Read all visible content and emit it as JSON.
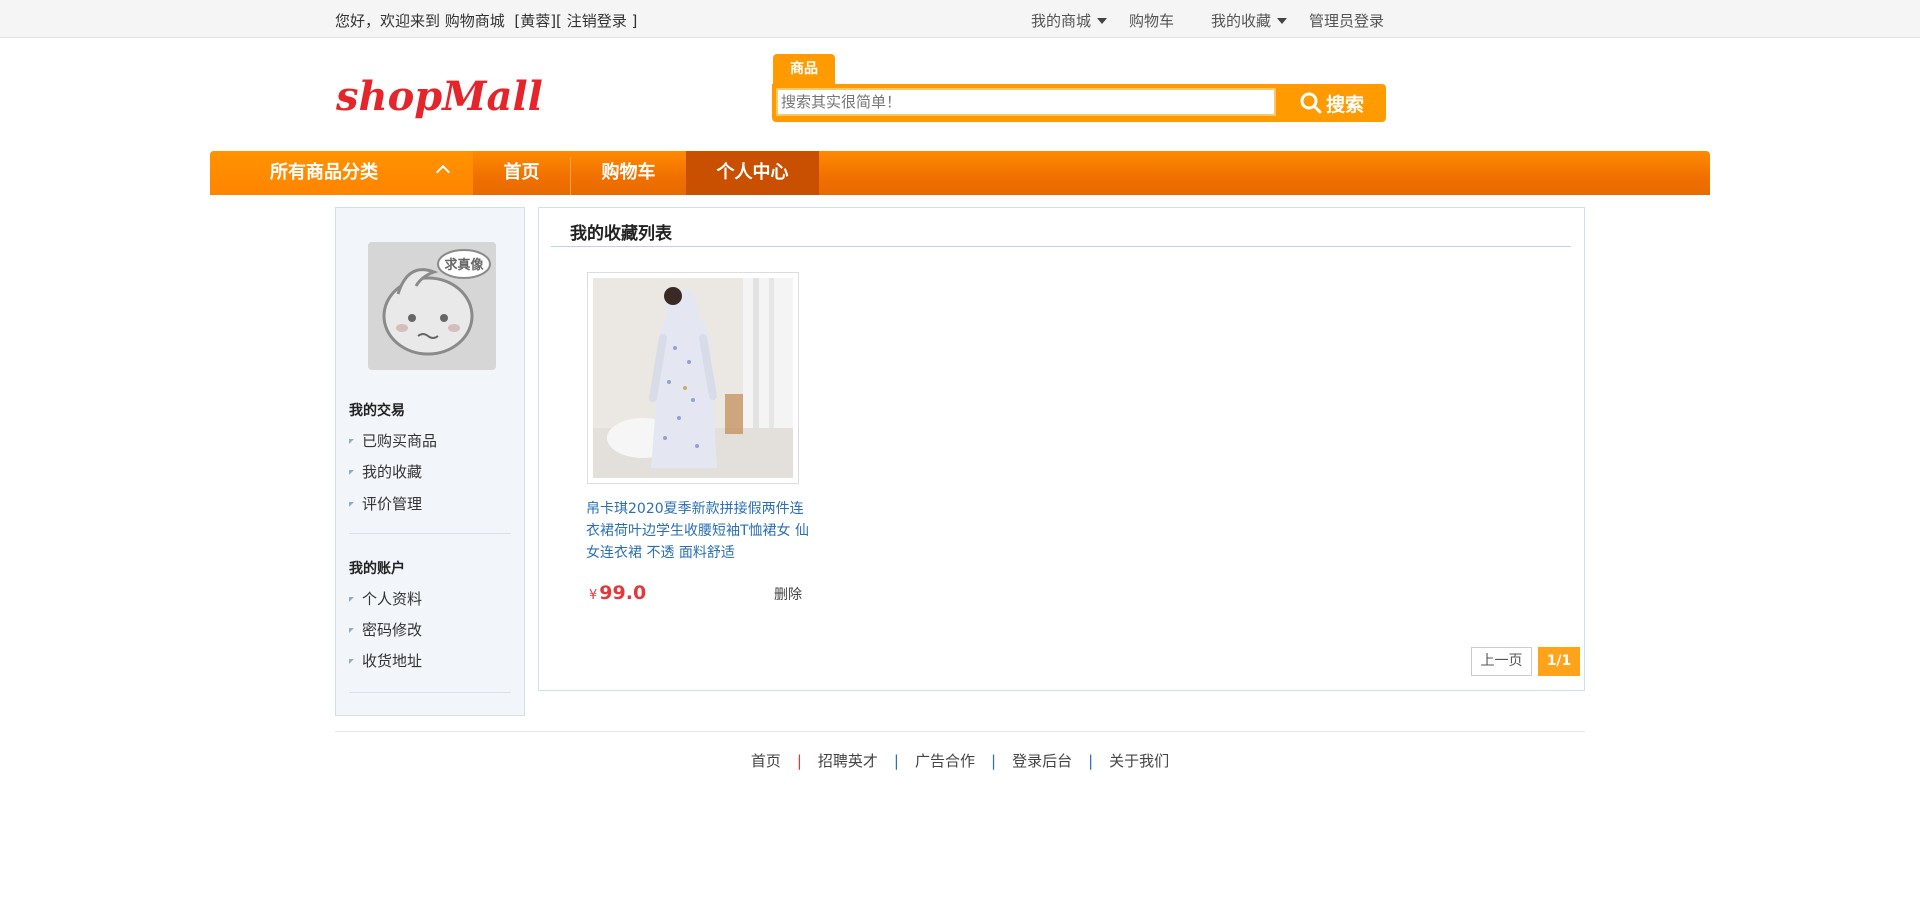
{
  "topbar": {
    "greeting": "您好，欢迎来到 购物商城",
    "user_open": "[",
    "username": "黄蓉",
    "user_close": "][",
    "logout": "注销登录",
    "logout_close": "]",
    "links": {
      "my_mall": "我的商城",
      "cart": "购物车",
      "favorites": "我的收藏",
      "admin_login": "管理员登录"
    }
  },
  "header": {
    "logo_text": "shopMall",
    "search_tab": "商品",
    "search_placeholder": "搜索其实很简单！",
    "search_button": "搜索"
  },
  "nav": {
    "all_categories": "所有商品分类",
    "items": [
      "首页",
      "购物车",
      "个人中心"
    ],
    "active": "个人中心"
  },
  "sidebar": {
    "avatar_badge": "求真像",
    "sections": [
      {
        "title": "我的交易",
        "links": [
          "已购买商品",
          "我的收藏",
          "评价管理"
        ]
      },
      {
        "title": "我的账户",
        "links": [
          "个人资料",
          "密码修改",
          "收货地址"
        ]
      }
    ]
  },
  "main": {
    "title": "我的收藏列表",
    "products": [
      {
        "name": "帛卡琪2020夏季新款拼接假两件连衣裙荷叶边学生收腰短袖T恤裙女 仙女连衣裙 不透 面料舒适",
        "currency": "¥",
        "price": "99.0",
        "delete_label": "删除"
      }
    ],
    "pagination": {
      "prev": "上一页",
      "current": "1/1"
    }
  },
  "footer": {
    "links": [
      "首页",
      "招聘英才",
      "广告合作",
      "登录后台",
      "关于我们"
    ]
  },
  "colors": {
    "accent_orange": "#ff8400",
    "nav_active": "#c85000",
    "price_red": "#e4393c",
    "link_blue": "#2a6fb8"
  }
}
